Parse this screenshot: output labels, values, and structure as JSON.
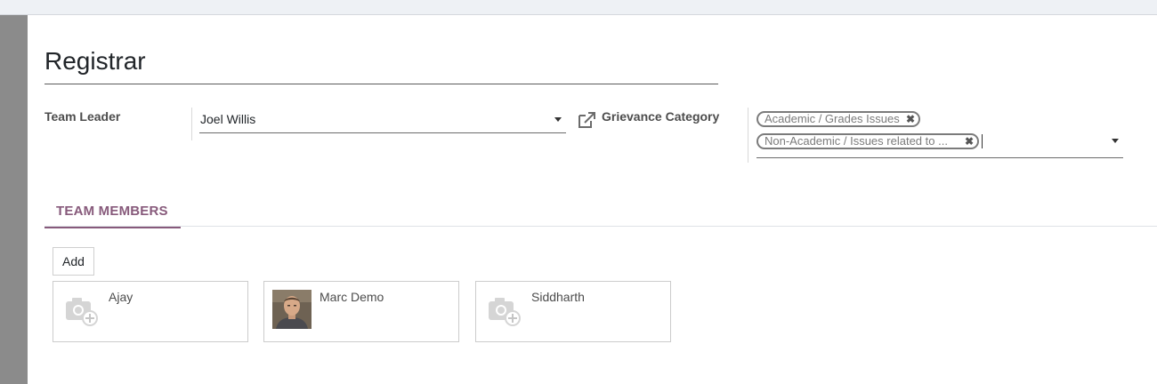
{
  "form": {
    "title": "Registrar",
    "team_leader_label": "Team Leader",
    "team_leader_value": "Joel Willis",
    "grievance_category_label": "Grievance Category",
    "grievance_tags": [
      {
        "label": "Academic / Grades Issues"
      },
      {
        "label": "Non-Academic / Issues related to ..."
      }
    ]
  },
  "tabs": [
    {
      "label": "TEAM MEMBERS",
      "active": true
    }
  ],
  "members": {
    "add_label": "Add",
    "items": [
      {
        "name": "Ajay",
        "avatar": "camera-placeholder-icon"
      },
      {
        "name": "Marc Demo",
        "avatar": "photo"
      },
      {
        "name": "Siddharth",
        "avatar": "camera-placeholder-icon"
      }
    ]
  },
  "colors": {
    "accent": "#875a7b",
    "tag_border": "#7b7b7b",
    "left_rail": "#8b8b8b"
  }
}
